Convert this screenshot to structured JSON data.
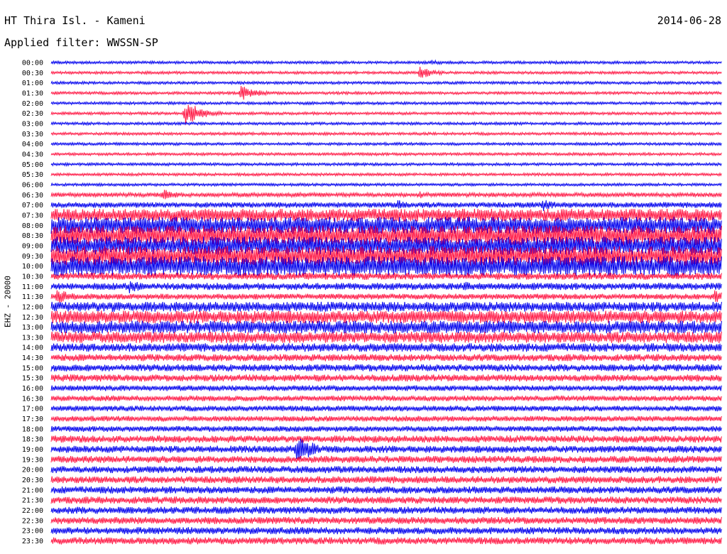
{
  "header": {
    "station": "HT Thira Isl. - Kameni",
    "date": "2014-06-28",
    "filter_text": "Applied filter: WWSSN-SP"
  },
  "chart_data": {
    "type": "line",
    "title": "HT Thira Isl. - Kameni",
    "subtitle": "Applied filter: WWSSN-SP",
    "ylabel": "EHZ - 20000",
    "xlabel": "",
    "grid": false,
    "rows": [
      "00:00",
      "00:30",
      "01:00",
      "01:30",
      "02:00",
      "02:30",
      "03:00",
      "03:30",
      "04:00",
      "04:30",
      "05:00",
      "05:30",
      "06:00",
      "06:30",
      "07:00",
      "07:30",
      "08:00",
      "08:30",
      "09:00",
      "09:30",
      "10:00",
      "10:30",
      "11:00",
      "11:30",
      "12:00",
      "12:30",
      "13:00",
      "13:30",
      "14:00",
      "14:30",
      "15:00",
      "15:30",
      "16:00",
      "16:30",
      "17:00",
      "17:30",
      "18:00",
      "18:30",
      "19:00",
      "19:30",
      "20:00",
      "20:30",
      "21:00",
      "21:30",
      "22:00",
      "22:30",
      "23:00",
      "23:30"
    ],
    "row_colors": [
      "#0000ee",
      "#ff1744"
    ],
    "noise_level": [
      2,
      2,
      2,
      2,
      2,
      2,
      2,
      2,
      2,
      2,
      2,
      2,
      2,
      3,
      4,
      9,
      12,
      14,
      13,
      14,
      14,
      5,
      5,
      4,
      7,
      9,
      9,
      8,
      6,
      5,
      5,
      5,
      4,
      4,
      4,
      4,
      4,
      5,
      5,
      5,
      5,
      5,
      5,
      5,
      5,
      5,
      5,
      5
    ],
    "events": [
      {
        "row": "00:00",
        "minute": 17.0,
        "amplitude": 4
      },
      {
        "row": "00:30",
        "minute": 16.5,
        "amplitude": 9
      },
      {
        "row": "01:30",
        "minute": 8.5,
        "amplitude": 11
      },
      {
        "row": "02:30",
        "minute": 6.0,
        "amplitude": 18
      },
      {
        "row": "06:30",
        "minute": 5.0,
        "amplitude": 8
      },
      {
        "row": "06:30",
        "minute": 16.5,
        "amplitude": 5
      },
      {
        "row": "07:00",
        "minute": 15.5,
        "amplitude": 8
      },
      {
        "row": "07:00",
        "minute": 22.0,
        "amplitude": 9
      },
      {
        "row": "11:00",
        "minute": 3.5,
        "amplitude": 10
      },
      {
        "row": "11:00",
        "minute": 18.5,
        "amplitude": 8
      },
      {
        "row": "11:30",
        "minute": 0.3,
        "amplitude": 12
      },
      {
        "row": "11:30",
        "minute": 29.7,
        "amplitude": 11
      },
      {
        "row": "19:00",
        "minute": 11.0,
        "amplitude": 22
      }
    ]
  }
}
